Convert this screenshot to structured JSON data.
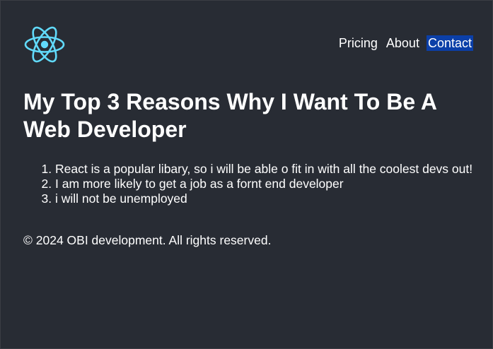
{
  "logo": {
    "icon": "react-logo-icon",
    "color": "#61dafb"
  },
  "nav": {
    "items": [
      {
        "label": "Pricing"
      },
      {
        "label": "About"
      },
      {
        "label": "Contact"
      }
    ],
    "active_color": "#0b3fa8"
  },
  "main": {
    "title": "My Top 3 Reasons Why I Want To Be A Web Developer",
    "reasons": [
      "React is a popular libary, so i will be able o fit in with all the coolest devs out!",
      "I am more likely to get a job as a fornt end developer",
      "i will not be unemployed"
    ]
  },
  "footer": {
    "text": "© 2024 OBI development. All rights reserved."
  },
  "colors": {
    "background": "#282c34",
    "text": "#ffffff"
  }
}
